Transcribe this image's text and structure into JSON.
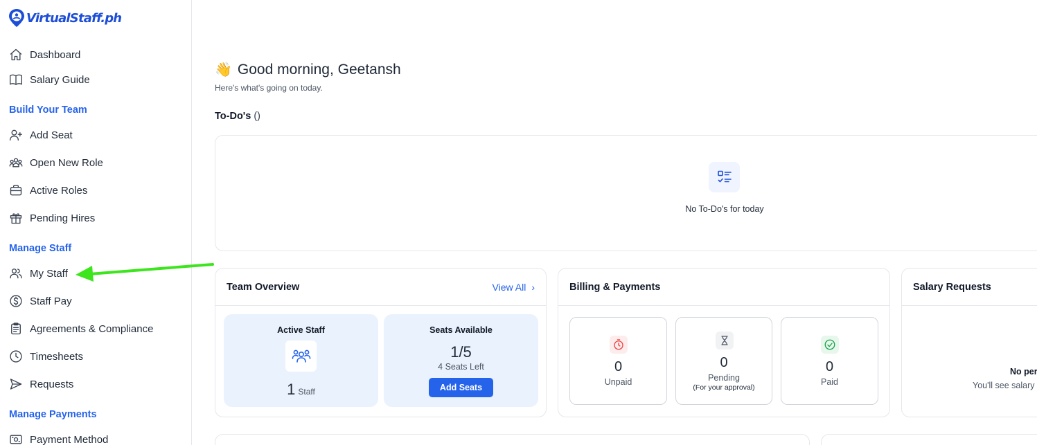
{
  "brand": {
    "name": "VirtualStaff.ph"
  },
  "sidebar": {
    "items": [
      {
        "label": "Dashboard",
        "icon": "home-icon"
      },
      {
        "label": "Salary Guide",
        "icon": "book-icon"
      }
    ],
    "sections": [
      {
        "title": "Build Your Team",
        "items": [
          {
            "label": "Add Seat",
            "icon": "user-plus-icon"
          },
          {
            "label": "Open New Role",
            "icon": "users-group-icon"
          },
          {
            "label": "Active Roles",
            "icon": "briefcase-icon"
          },
          {
            "label": "Pending Hires",
            "icon": "gift-icon"
          }
        ]
      },
      {
        "title": "Manage Staff",
        "items": [
          {
            "label": "My Staff",
            "icon": "users-icon"
          },
          {
            "label": "Staff Pay",
            "icon": "dollar-circle-icon"
          },
          {
            "label": "Agreements & Compliance",
            "icon": "clipboard-icon"
          },
          {
            "label": "Timesheets",
            "icon": "clock-icon"
          },
          {
            "label": "Requests",
            "icon": "send-icon"
          }
        ]
      },
      {
        "title": "Manage Payments",
        "items": [
          {
            "label": "Payment Method",
            "icon": "payment-card-icon"
          }
        ]
      }
    ]
  },
  "main": {
    "greeting": "Good morning, Geetansh",
    "subtitle": "Here's what's going on today.",
    "todos": {
      "title": "To-Do's",
      "count": "()",
      "empty_text": "No To-Do's for today"
    },
    "team_overview": {
      "title": "Team Overview",
      "view_all": "View All",
      "active_staff": {
        "label": "Active Staff",
        "value": "1",
        "unit": "Staff"
      },
      "seats": {
        "label": "Seats Available",
        "value": "1/5",
        "left": "4 Seats Left",
        "button": "Add Seats"
      }
    },
    "billing": {
      "title": "Billing & Payments",
      "unpaid": {
        "value": "0",
        "label": "Unpaid"
      },
      "pending": {
        "value": "0",
        "label": "Pending",
        "note": "(For your approval)"
      },
      "paid": {
        "value": "0",
        "label": "Paid"
      }
    },
    "salary_requests": {
      "title": "Salary Requests",
      "empty_title": "No per",
      "empty_sub": "You'll see salary"
    }
  },
  "colors": {
    "accent": "#2563eb",
    "tile_bg": "#eaf2fd",
    "unpaid": "#ef4444",
    "paid": "#16a34a",
    "annotation_arrow": "#3ce51c"
  }
}
